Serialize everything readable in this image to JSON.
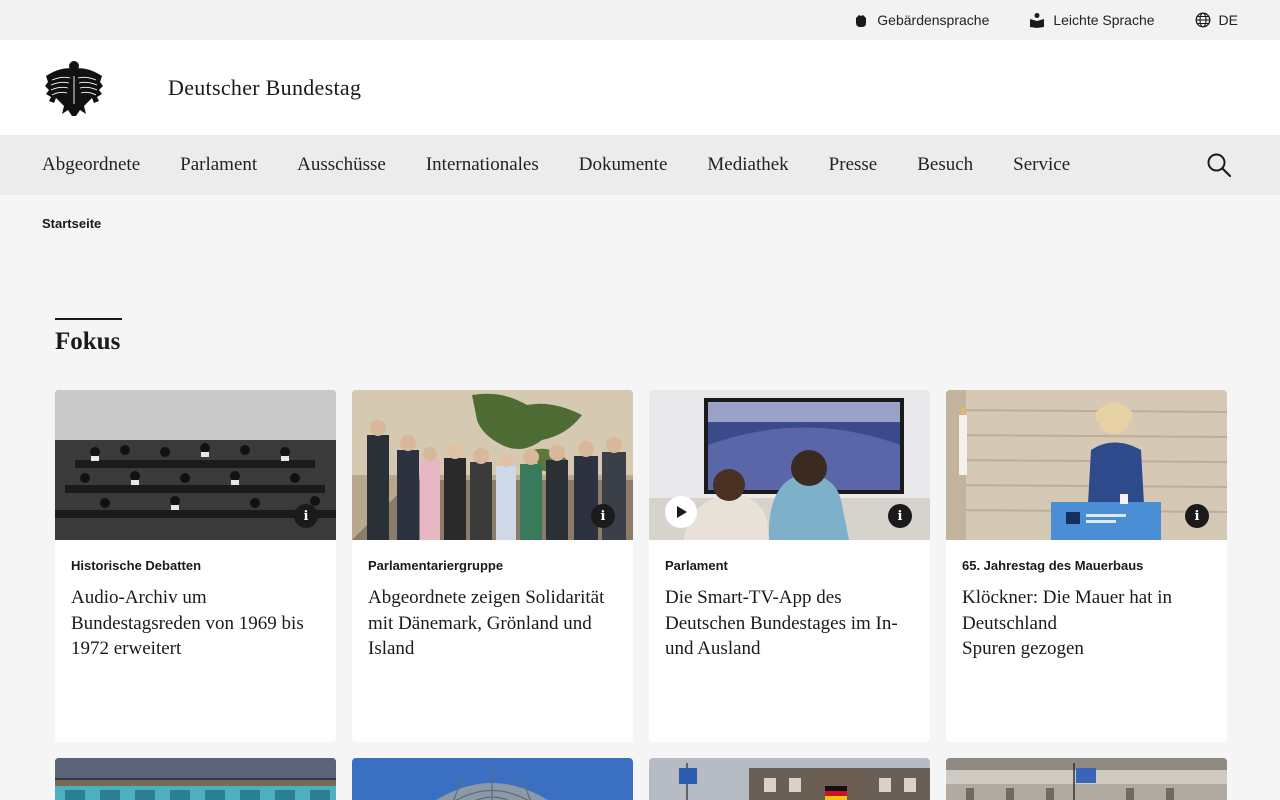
{
  "utility": {
    "sign_language": "Gebärdensprache",
    "easy_language": "Leichte Sprache",
    "language": "DE"
  },
  "header": {
    "site_title": "Deutscher Bundestag"
  },
  "nav": {
    "items": [
      "Abgeordnete",
      "Parlament",
      "Ausschüsse",
      "Internationales",
      "Dokumente",
      "Mediathek",
      "Presse",
      "Besuch",
      "Service"
    ]
  },
  "breadcrumb": {
    "home": "Startseite"
  },
  "section": {
    "title": "Fokus"
  },
  "cards": [
    {
      "category": "Historische Debatten",
      "title": "Audio-Archiv um Bundestagsreden von 1969 bis 1972 erweitert",
      "has_video": false
    },
    {
      "category": "Parlamentariergruppe",
      "title": "Abgeordnete zeigen Solidarität mit Dänemark, Grönland und Island",
      "has_video": false
    },
    {
      "category": "Parlament",
      "title": "Die Smart-TV-App des Deutschen Bundestages im In- und Ausland",
      "has_video": true
    },
    {
      "category": "65. Jahrestag des Mauerbaus",
      "title": "Klöckner: Die Mauer hat in Deutschland\nSpuren gezogen",
      "has_video": false
    }
  ],
  "icons": {
    "info": "i"
  },
  "colors": {
    "page_bg": "#f5f5f5",
    "nav_bg": "#ececec",
    "utility_bg": "#f2f2f2",
    "text": "#1a1a1a"
  }
}
